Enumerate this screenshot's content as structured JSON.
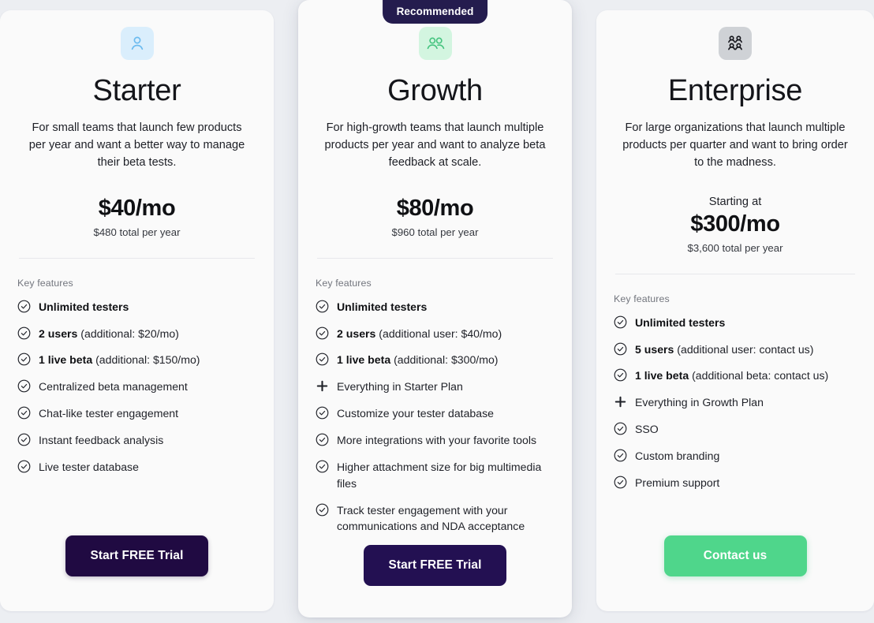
{
  "page": {
    "background": "#eceef2",
    "card_background": "#fafafa"
  },
  "badge": {
    "label": "Recommended",
    "color": "#241c4e"
  },
  "features_heading": "Key features",
  "plans": [
    {
      "id": "starter",
      "name": "Starter",
      "icon": "single-user-icon",
      "icon_bg": "#daeefc",
      "icon_color": "#6cbbef",
      "description": "For small teams that launch few products per year and want a better way to manage their beta tests.",
      "price_prefix": "",
      "price": "$40/mo",
      "price_sub": "$480 total per year",
      "features": [
        {
          "icon": "check-circle-icon",
          "bold": "Unlimited testers",
          "rest": ""
        },
        {
          "icon": "check-circle-icon",
          "bold": "2 users",
          "rest": " (additional: $20/mo)"
        },
        {
          "icon": "check-circle-icon",
          "bold": "1 live beta",
          "rest": " (additional: $150/mo)"
        },
        {
          "icon": "check-circle-icon",
          "bold": "",
          "rest": "Centralized beta management"
        },
        {
          "icon": "check-circle-icon",
          "bold": "",
          "rest": "Chat-like tester engagement"
        },
        {
          "icon": "check-circle-icon",
          "bold": "",
          "rest": "Instant feedback analysis"
        },
        {
          "icon": "check-circle-icon",
          "bold": "",
          "rest": "Live tester database"
        }
      ],
      "cta": {
        "label": "Start FREE Trial",
        "style": "dark",
        "color": "#200a42"
      }
    },
    {
      "id": "growth",
      "name": "Growth",
      "icon": "two-users-icon",
      "icon_bg": "#d3f5e0",
      "icon_color": "#45c47f",
      "description": "For high-growth teams that launch multiple products per year and want to analyze beta feedback at scale.",
      "price_prefix": "",
      "price": "$80/mo",
      "price_sub": "$960 total per year",
      "features": [
        {
          "icon": "check-circle-icon",
          "bold": "Unlimited testers",
          "rest": ""
        },
        {
          "icon": "check-circle-icon",
          "bold": "2 users",
          "rest": " (additional user: $40/mo)"
        },
        {
          "icon": "check-circle-icon",
          "bold": "1 live beta",
          "rest": " (additional: $300/mo)"
        },
        {
          "icon": "plus-icon",
          "bold": "",
          "rest": "Everything in Starter Plan"
        },
        {
          "icon": "check-circle-icon",
          "bold": "",
          "rest": "Customize your tester database"
        },
        {
          "icon": "check-circle-icon",
          "bold": "",
          "rest": "More integrations with your favorite tools"
        },
        {
          "icon": "check-circle-icon",
          "bold": "",
          "rest": "Higher attachment size for big multimedia files"
        },
        {
          "icon": "check-circle-icon",
          "bold": "",
          "rest": "Track tester engagement with your communications and NDA acceptance"
        }
      ],
      "cta": {
        "label": "Start FREE Trial",
        "style": "featured",
        "color": "#231052"
      }
    },
    {
      "id": "enterprise",
      "name": "Enterprise",
      "icon": "four-users-icon",
      "icon_bg": "#cfd2d6",
      "icon_color": "#13141a",
      "description": "For large organizations that launch multiple products per quarter and want to bring order to the madness.",
      "price_prefix": "Starting at",
      "price": "$300/mo",
      "price_sub": "$3,600 total per year",
      "features": [
        {
          "icon": "check-circle-icon",
          "bold": "Unlimited testers",
          "rest": ""
        },
        {
          "icon": "check-circle-icon",
          "bold": "5 users",
          "rest": " (additional user: contact us)"
        },
        {
          "icon": "check-circle-icon",
          "bold": "1 live beta",
          "rest": " (additional beta: contact us)"
        },
        {
          "icon": "plus-icon",
          "bold": "",
          "rest": "Everything in Growth Plan"
        },
        {
          "icon": "check-circle-icon",
          "bold": "",
          "rest": "SSO"
        },
        {
          "icon": "check-circle-icon",
          "bold": "",
          "rest": "Custom branding"
        },
        {
          "icon": "check-circle-icon",
          "bold": "",
          "rest": "Premium support"
        }
      ],
      "cta": {
        "label": "Contact us",
        "style": "green",
        "color": "#4fd68b"
      }
    }
  ]
}
